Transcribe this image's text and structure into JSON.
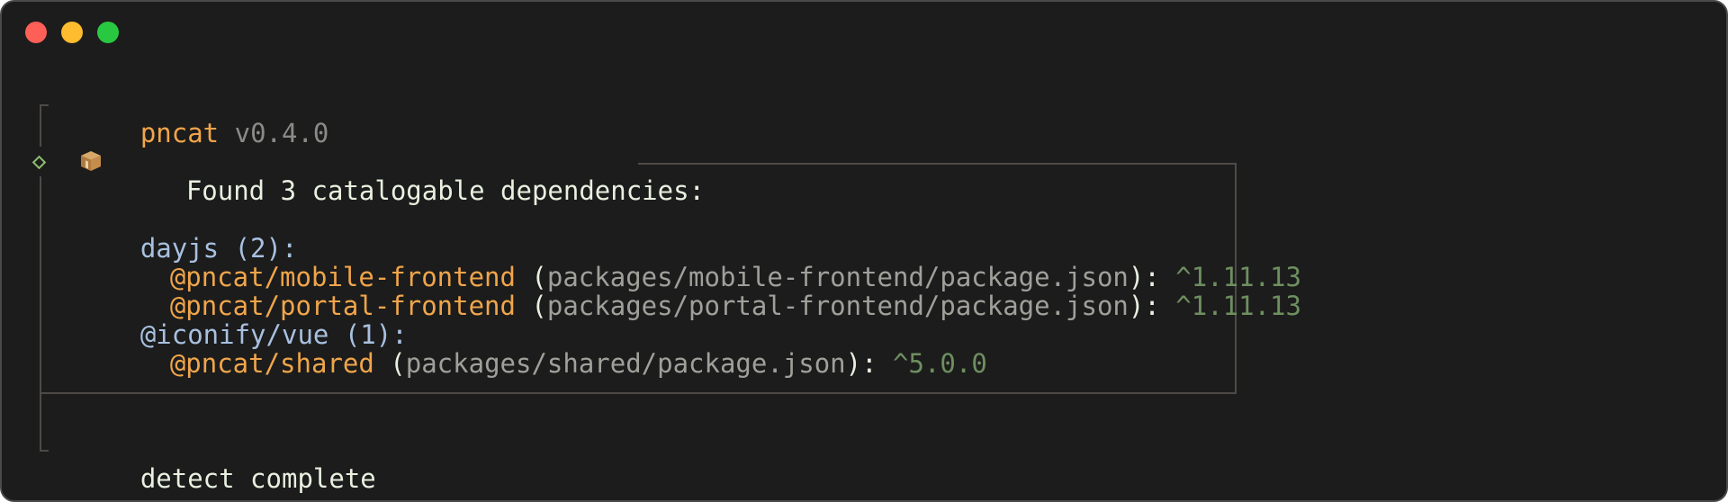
{
  "window": {
    "controls": [
      "close",
      "minimize",
      "zoom"
    ]
  },
  "header": {
    "app_name": "pncat",
    "version": "v0.4.0"
  },
  "found": {
    "icon": "package-box-icon",
    "text": "Found 3 catalogable dependencies:"
  },
  "groups": [
    {
      "label": "dayjs (2):",
      "entries": [
        {
          "package": "@pncat/mobile-frontend",
          "path": "packages/mobile-frontend/package.json",
          "version": "^1.11.13"
        },
        {
          "package": "@pncat/portal-frontend",
          "path": "packages/portal-frontend/package.json",
          "version": "^1.11.13"
        }
      ]
    },
    {
      "label": "@iconify/vue (1):",
      "entries": [
        {
          "package": "@pncat/shared",
          "path": "packages/shared/package.json",
          "version": "^5.0.0"
        }
      ]
    }
  ],
  "footer": {
    "status": "detect complete"
  },
  "colors": {
    "background": "#1c1c1c",
    "accent_orange": "#f0a54a",
    "path_gray": "#8a8a86",
    "version_green": "#6e8f60",
    "group_blue": "#a8c0e0"
  }
}
